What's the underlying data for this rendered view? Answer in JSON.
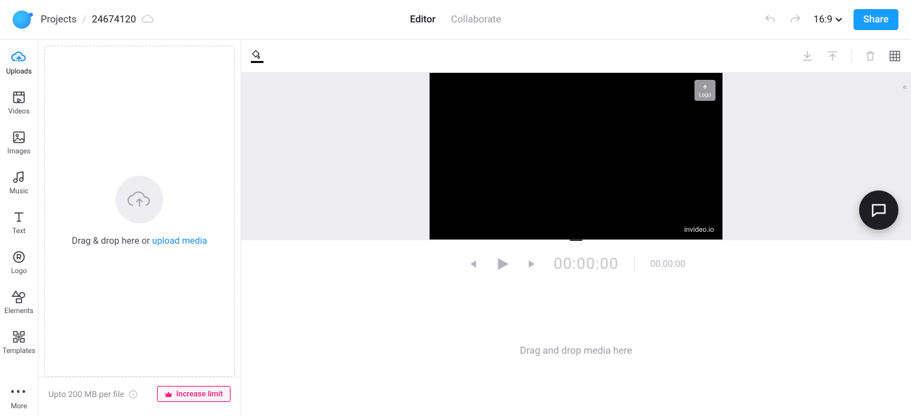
{
  "breadcrumb": {
    "root": "Projects",
    "project_id": "24674120"
  },
  "tabs": {
    "editor": "Editor",
    "collaborate": "Collaborate"
  },
  "toolbar": {
    "ratio": "16:9",
    "share": "Share"
  },
  "rail": {
    "uploads": "Uploads",
    "videos": "Videos",
    "images": "Images",
    "music": "Music",
    "text": "Text",
    "logo": "Logo",
    "elements": "Elements",
    "templates": "Templates",
    "more": "More"
  },
  "upload_panel": {
    "drop_text": "Drag & drop here or ",
    "link_text": "upload media",
    "limit_text": "Upto 200 MB per file",
    "increase": "Increase limit"
  },
  "canvas": {
    "logo_chip": "Logo",
    "watermark": "invideo.io"
  },
  "playback": {
    "current": "00:00:00",
    "duration": "00:00:00"
  },
  "timeline": {
    "drop_hint": "Drag and drop media here"
  }
}
